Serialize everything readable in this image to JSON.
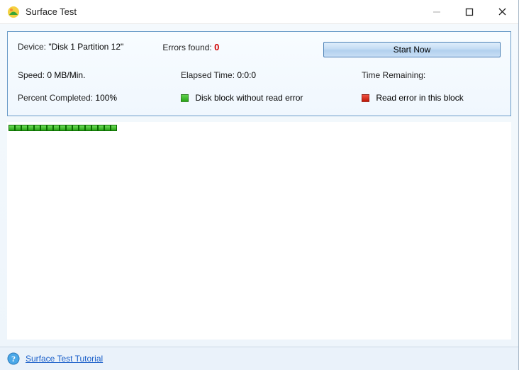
{
  "window": {
    "title": "Surface Test"
  },
  "info": {
    "device_label": "Device:",
    "device_value": "\"Disk 1 Partition 12\"",
    "errors_label": "Errors found:",
    "errors_value": "0",
    "start_button": "Start Now",
    "speed_label": "Speed:",
    "speed_value": "0 MB/Min.",
    "elapsed_label": "Elapsed Time:",
    "elapsed_value": "0:0:0",
    "remaining_label": "Time Remaining:",
    "remaining_value": "",
    "percent_label": "Percent Completed:",
    "percent_value": "100%",
    "legend_ok": "Disk block without read error",
    "legend_err": "Read error in this block"
  },
  "blocks": {
    "count": 17,
    "status": "ok"
  },
  "footer": {
    "tutorial_link": "Surface Test Tutorial"
  }
}
